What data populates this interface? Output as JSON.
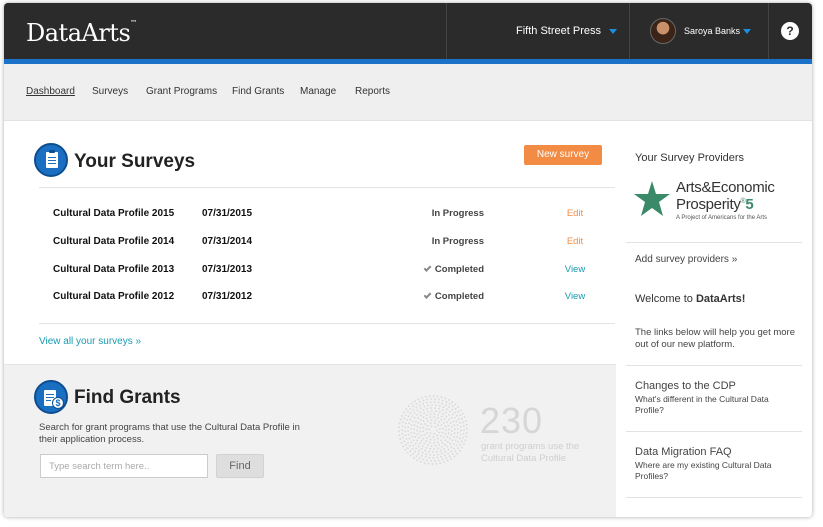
{
  "header": {
    "logo": "DataArts",
    "logo_mark": "™",
    "organization": "Fifth Street Press",
    "user_name": "Saroya Banks",
    "help_label": "?"
  },
  "nav": [
    "Dashboard",
    "Surveys",
    "Grant Programs",
    "Find Grants",
    "Manage",
    "Reports"
  ],
  "surveys": {
    "title": "Your Surveys",
    "new_button": "New survey",
    "rows": [
      {
        "name": "Cultural Data Profile 2015",
        "date": "07/31/2015",
        "status": "In Progress",
        "action": "Edit",
        "completed": false
      },
      {
        "name": "Cultural Data Profile 2014",
        "date": "07/31/2014",
        "status": "In Progress",
        "action": "Edit",
        "completed": false
      },
      {
        "name": "Cultural Data Profile 2013",
        "date": "07/31/2013",
        "status": "Completed",
        "action": "View",
        "completed": true
      },
      {
        "name": "Cultural Data Profile 2012",
        "date": "07/31/2012",
        "status": "Completed",
        "action": "View",
        "completed": true
      }
    ],
    "view_all": "View all your surveys »"
  },
  "grants": {
    "title": "Find Grants",
    "description": "Search for grant programs that use the Cultural Data Profile in their application process.",
    "search_placeholder": "Type search term here..",
    "find_button": "Find",
    "count": "230",
    "count_caption": "grant programs use the Cultural Data Profile"
  },
  "sidebar": {
    "providers_title": "Your Survey Providers",
    "provider_logo_line1": "Arts&Economic",
    "provider_logo_line2": "Prosperity",
    "provider_logo_mark": "®",
    "provider_logo_number": "5",
    "provider_logo_tagline": "A Project of Americans for the Arts",
    "add_provider": "Add survey providers »",
    "welcome_prefix": "Welcome to ",
    "welcome_brand": "DataArts!",
    "welcome_text": "The links below will help you get more out of our new platform.",
    "links": [
      {
        "title": "Changes to the CDP",
        "sub": "What's different in the Cultural Data Profile?"
      },
      {
        "title": "Data Migration FAQ",
        "sub": "Where are my existing Cultural Data Profiles?"
      }
    ]
  },
  "colors": {
    "accent_blue": "#1a73c9",
    "orange": "#f28c45",
    "teal": "#1a9bb0",
    "green": "#3a8a6a"
  }
}
